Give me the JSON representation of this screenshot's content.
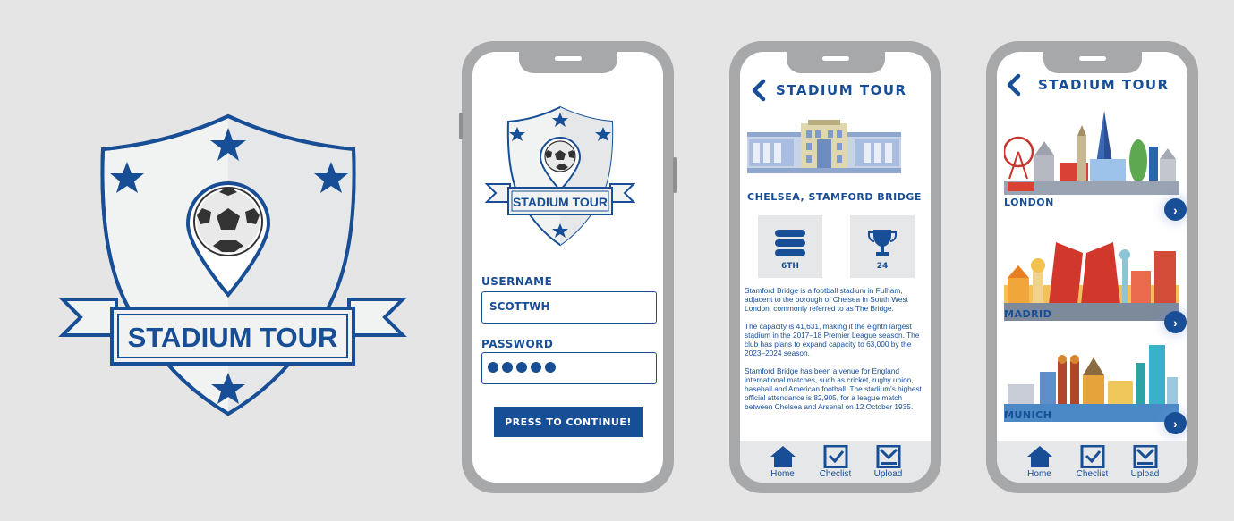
{
  "logo": {
    "text": "STADIUM TOUR"
  },
  "login": {
    "username_label": "USERNAME",
    "username_value": "SCOTTWH",
    "password_label": "PASSWORD",
    "continue_label": "PRESS TO CONTINUE!"
  },
  "header": {
    "title": "STADIUM TOUR"
  },
  "stadium": {
    "name": "CHELSEA, STAMFORD BRIDGE",
    "stats": [
      {
        "icon": "stack-icon",
        "value": "6TH"
      },
      {
        "icon": "trophy-icon",
        "value": "24"
      }
    ],
    "paragraphs": [
      "Stamford Bridge is a football stadium in Fulham, adjacent to the borough of Chelsea in South West London, commonly referred to as The Bridge.",
      "The capacity is 41,631, making it the eighth largest stadium in the 2017–18 Premier League season. The club has plans to expand capacity to 63,000 by the 2023–2024 season.",
      "Stamford Bridge has been a venue for England international matches, such as cricket, rugby union, baseball and American football. The stadium's highest official attendance is 82,905, for a league match between Chelsea and Arsenal on 12 October 1935."
    ]
  },
  "cities": [
    {
      "name": "LONDON"
    },
    {
      "name": "MADRID"
    },
    {
      "name": "MUNICH"
    }
  ],
  "nav": {
    "home": "Home",
    "checklist": "Checlist",
    "upload": "Upload"
  },
  "colors": {
    "brand": "#174e96",
    "frame": "#a7a8aa",
    "background": "#e5e5e6"
  }
}
